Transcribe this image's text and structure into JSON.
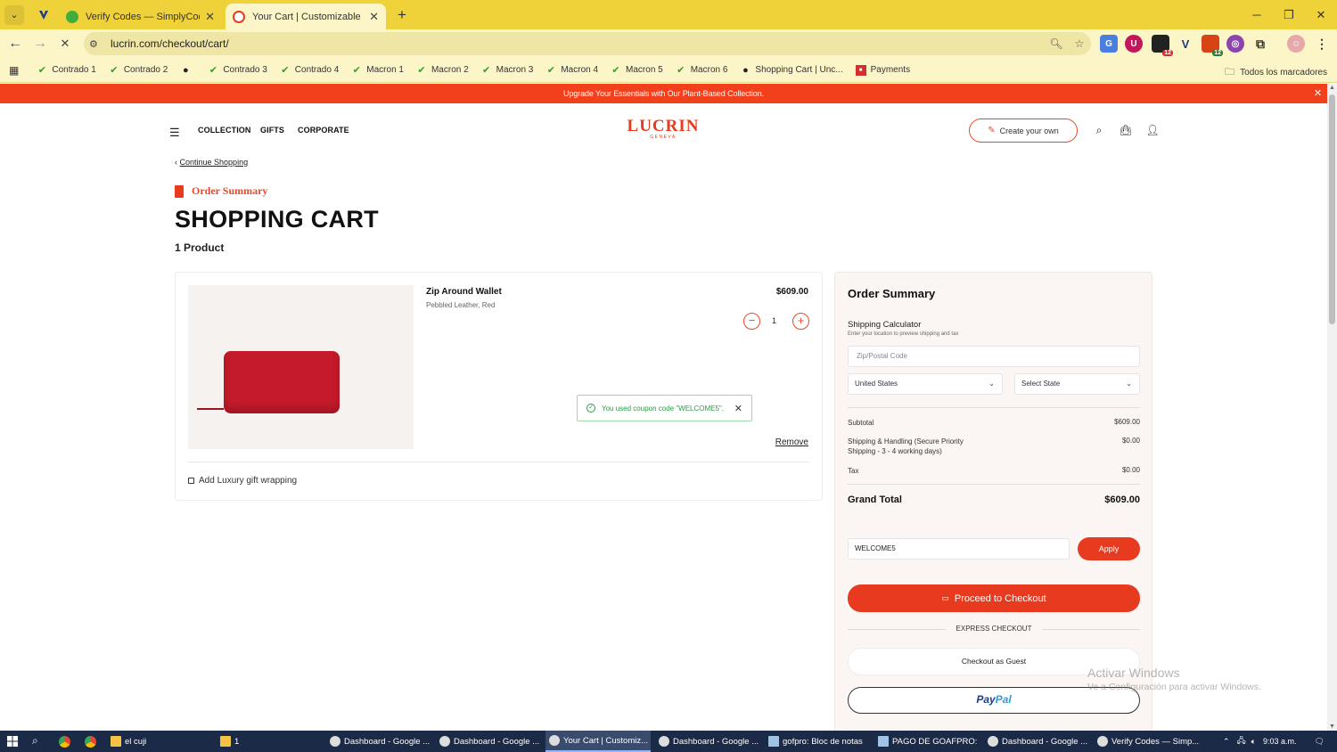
{
  "browser": {
    "tabs": [
      {
        "title": "Verify Codes — SimplyCodes",
        "active": false
      },
      {
        "title": "Your Cart | Customizable Leath",
        "active": true
      }
    ],
    "url": "lucrin.com/checkout/cart/",
    "extension_badges": [
      "12",
      "12"
    ],
    "bookmarks": [
      "Contrado 1",
      "Contrado 2",
      "",
      "Contrado 3",
      "Contrado 4",
      "Macron 1",
      "Macron 2",
      "Macron 3",
      "Macron 4",
      "Macron 5",
      "Macron 6",
      "Shopping Cart | Unc...",
      "Payments"
    ],
    "all_bookmarks": "Todos los marcadores"
  },
  "promo": {
    "text": "Upgrade Your Essentials with Our Plant-Based Collection."
  },
  "header": {
    "nav": [
      "COLLECTION",
      "GIFTS",
      "CORPORATE"
    ],
    "logo": "LUCRIN",
    "logo_sub": "GENEVA",
    "create_button": "Create your own",
    "accent_color": "#e83a1e"
  },
  "cart": {
    "continue_label": "Continue Shopping",
    "section_label": "Order Summary",
    "title": "SHOPPING CART",
    "count_label": "1 Product",
    "item": {
      "name": "Zip Around Wallet",
      "variant": "Pebbled Leather, Red",
      "price": "$609.00",
      "quantity": "1",
      "remove_label": "Remove"
    },
    "coupon_message": "You used coupon code \"WELCOME5\".",
    "gift_wrap_label": "Add Luxury gift wrapping"
  },
  "summary": {
    "title": "Order Summary",
    "shipping_title": "Shipping Calculator",
    "shipping_sub": "Enter your location to preview shipping and tax",
    "zip_placeholder": "Zip/Postal Code",
    "country": "United States",
    "state_placeholder": "Select State",
    "subtotal_label": "Subtotal",
    "subtotal": "$609.00",
    "shipping_label": "Shipping & Handling (Secure Priority Shipping - 3 - 4 working days)",
    "shipping": "$0.00",
    "tax_label": "Tax",
    "tax": "$0.00",
    "grand_label": "Grand Total",
    "grand_total": "$609.00",
    "coupon_value": "WELCOME5",
    "apply_label": "Apply",
    "checkout_label": "Proceed to Checkout",
    "express_label": "EXPRESS CHECKOUT",
    "guest_label": "Checkout as Guest",
    "paypal_a": "Pay",
    "paypal_b": "Pal"
  },
  "watermark": {
    "line1": "Activar Windows",
    "line2": "Ve a Configuración para activar Windows."
  },
  "taskbar": {
    "items": [
      "el cuji",
      "1",
      "Dashboard - Google ...",
      "Dashboard - Google ...",
      "Your Cart | Customiz...",
      "Dashboard - Google ...",
      "gofpro: Bloc de notas",
      "PAGO DE GOAFPRO: ...",
      "Dashboard - Google ...",
      "Verify Codes — Simp..."
    ],
    "time": "9:03 a.m."
  }
}
